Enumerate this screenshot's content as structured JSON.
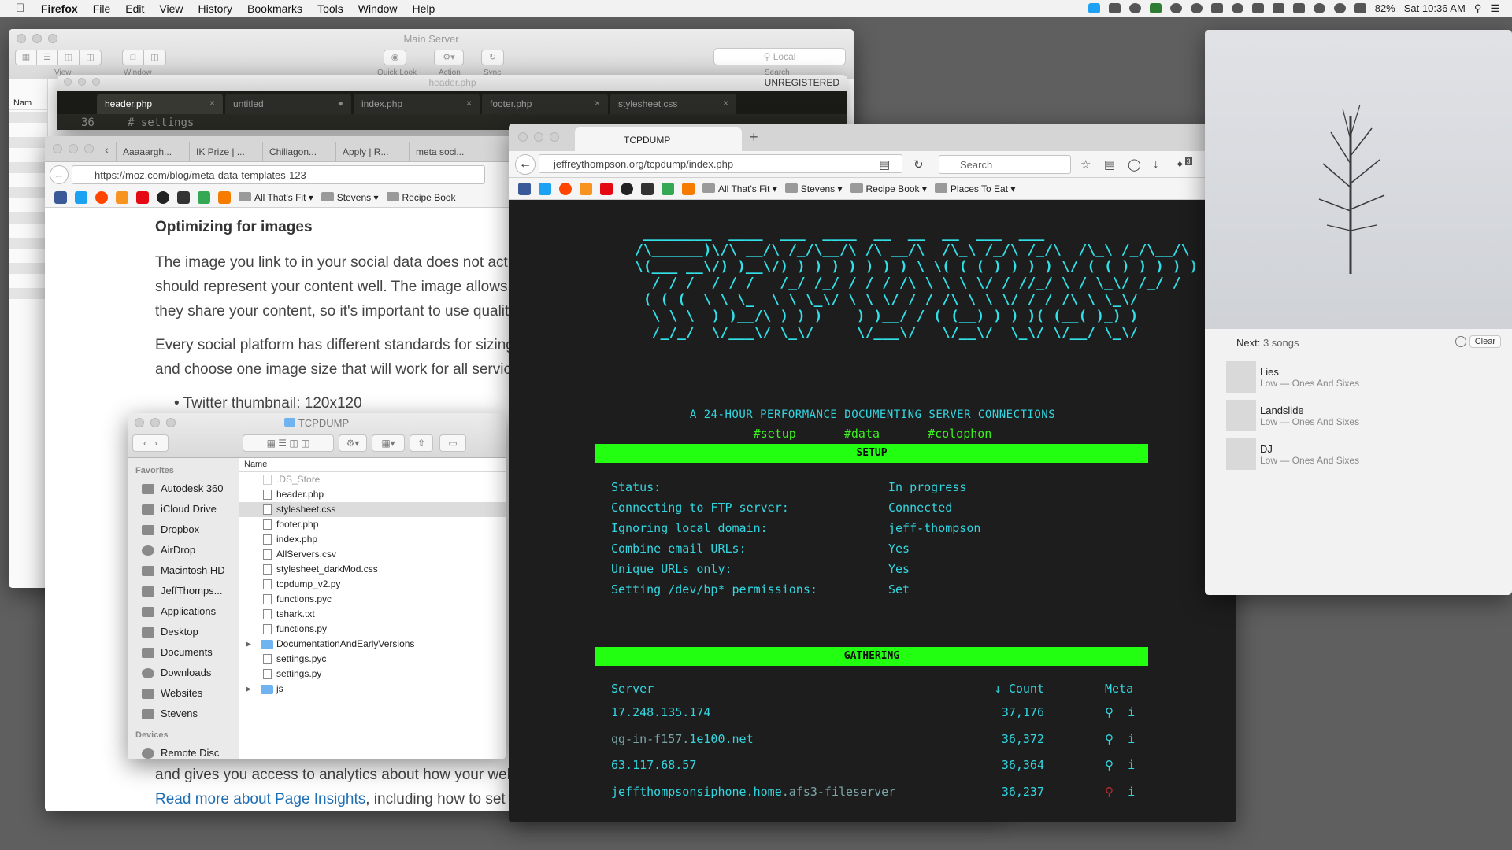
{
  "menubar": {
    "app": "Firefox",
    "items": [
      "File",
      "Edit",
      "View",
      "History",
      "Bookmarks",
      "Tools",
      "Window",
      "Help"
    ],
    "battery": "82%",
    "clock": "Sat 10:36 AM"
  },
  "finder_back": {
    "title": "Main Server",
    "labels": {
      "view": "View",
      "window": "Window",
      "quicklook": "Quick Look",
      "action": "Action",
      "sync": "Sync",
      "search": "Search"
    },
    "search_placeholder": "Local",
    "name_col": "Nam",
    "line_no": "36"
  },
  "sublime": {
    "title": "header.php",
    "registered": "UNREGISTERED",
    "tabs": [
      "header.php",
      "untitled",
      "index.php",
      "footer.php",
      "stylesheet.css"
    ],
    "code_line": "# settings"
  },
  "ff_back": {
    "tabs": [
      "Aaaaargh...",
      "IK Prize | ...",
      "Chiliagon...",
      "Apply | R...",
      "meta soci..."
    ],
    "url": "https://moz.com/blog/meta-data-templates-123",
    "bookmarks": [
      "All That's Fit",
      "Stevens",
      "Recipe Book"
    ],
    "article": {
      "heading": "Optimizing for images",
      "p1": "The image you link to in your social data does not actually",
      "p1b": "should represent your content well. The image allows you",
      "p1c": "they share your content, so it's important to use quality im",
      "p2": "Every social platform has different standards for sizing. Ty",
      "p2b": "and choose one image size that will work for all services.",
      "p3": "Twitter thumbnail: 120x120",
      "p4": "and gives you access to analytics about how your website",
      "link": "Read more about Page Insights",
      "p5": ", including how to set it up a"
    }
  },
  "finder_front": {
    "title": "TCPDUMP",
    "favorites_label": "Favorites",
    "favorites": [
      "Autodesk 360",
      "iCloud Drive",
      "Dropbox",
      "AirDrop",
      "Macintosh HD",
      "JeffThomps...",
      "Applications",
      "Desktop",
      "Documents",
      "Downloads",
      "Websites",
      "Stevens"
    ],
    "devices_label": "Devices",
    "devices": [
      "Remote Disc"
    ],
    "name_header": "Name",
    "files": [
      ".DS_Store",
      "header.php",
      "stylesheet.css",
      "footer.php",
      "index.php",
      "AllServers.csv",
      "stylesheet_darkMod.css",
      "tcpdump_v2.py",
      "functions.pyc",
      "tshark.txt",
      "functions.py",
      "DocumentationAndEarlyVersions",
      "settings.pyc",
      "settings.py",
      "js"
    ]
  },
  "tcp": {
    "tab_title": "TCPDUMP",
    "url": "jeffreythompson.org/tcpdump/index.php",
    "search_placeholder": "Search",
    "badge": "3",
    "bookmarks": [
      "All That's Fit",
      "Stevens",
      "Recipe Book",
      "Places To Eat"
    ],
    "ascii_art": " ________  ____  ___  ____  __  __  __  ___  ___\n/\\______)\\/\\ __/\\ /_/\\__/\\ /\\ __/\\  /\\_\\ /_/\\ /_/\\  /\\_\\ /_/\\__/\\\n\\(___ __\\/) )__\\/) ) ) ) ) ) ) ) \\ \\( ( ( ) ) ) ) \\/ ( ( ) ) ) ) )\n  / / /  / / /   /_/ /_/ / / / /\\ \\ \\ \\ \\/ / //_/ \\ / \\_\\/ /_/ /\n ( ( (  \\ \\ \\_  \\ \\ \\_\\/ \\ \\ \\/ / / /\\ \\ \\ \\/ / / /\\ \\ \\_\\/\n  \\ \\ \\  ) )__/\\ ) ) )    ) )__/ / ( (__) ) ) )( (__( )_) )\n  /_/_/  \\/___\\/ \\_\\/     \\/___\\/   \\/__\\/  \\_\\/ \\/__/ \\_\\/",
    "subtitle": "A 24-HOUR PERFORMANCE DOCUMENTING SERVER CONNECTIONS",
    "nav": [
      "#setup",
      "#data",
      "#colophon"
    ],
    "setup_header": "SETUP",
    "setup_rows": [
      {
        "k": "Status:",
        "v": "In progress"
      },
      {
        "k": "Connecting to FTP server:",
        "v": "Connected"
      },
      {
        "k": "Ignoring local domain:",
        "v": "jeff-thompson"
      },
      {
        "k": "Combine email URLs:",
        "v": "Yes"
      },
      {
        "k": "Unique URLs only:",
        "v": "Yes"
      },
      {
        "k": "Setting /dev/bp* permissions:",
        "v": "Set"
      }
    ],
    "gathering_header": "GATHERING",
    "table_headers": {
      "server": "Server",
      "count": "↓ Count",
      "meta": "Meta"
    },
    "rows": [
      {
        "pre": "",
        "main": "17.248.135.174",
        "post": "",
        "count": "37,176",
        "pin": "blue"
      },
      {
        "pre": "qg-in-f157.",
        "main": "1e100.net",
        "post": "",
        "count": "36,372",
        "pin": "blue"
      },
      {
        "pre": "",
        "main": "63.117.68.57",
        "post": "",
        "count": "36,364",
        "pin": "blue"
      },
      {
        "pre": "",
        "main": "jeffthompsonsiphone.home",
        "post": ".afs3-fileserver",
        "count": "36,237",
        "pin": "red"
      }
    ]
  },
  "music": {
    "next_label": "Next:",
    "next_count": "3 songs",
    "clear": "Clear",
    "songs": [
      {
        "title": "Lies",
        "artist": "Low — Ones And Sixes"
      },
      {
        "title": "Landslide",
        "artist": "Low — Ones And Sixes"
      },
      {
        "title": "DJ",
        "artist": "Low — Ones And Sixes"
      }
    ]
  }
}
